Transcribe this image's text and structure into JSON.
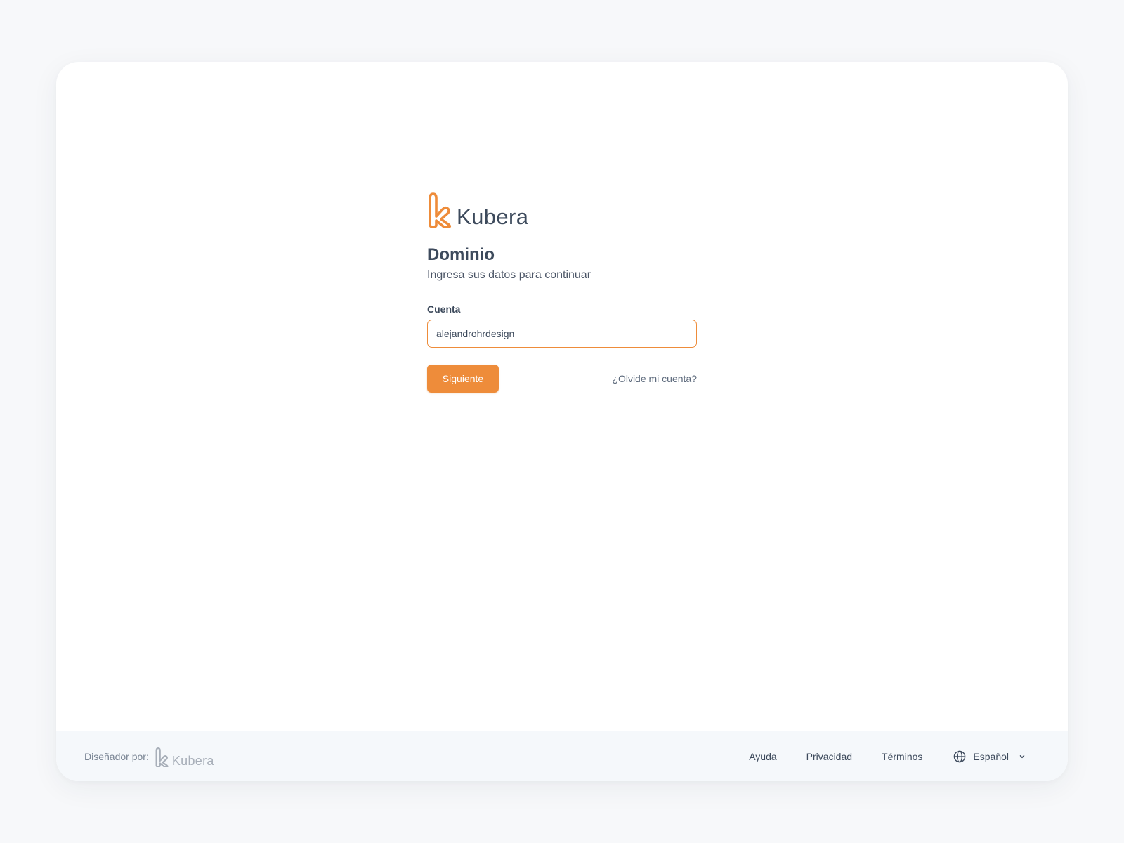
{
  "brand": {
    "name": "Kubera",
    "mark_icon": "kubera-k-logo-icon",
    "accent_color": "#ee8c3a"
  },
  "login": {
    "title": "Dominio",
    "subtitle": "Ingresa sus datos para continuar",
    "account_label": "Cuenta",
    "account_value": "alejandrohrdesign",
    "next_button": "Siguiente",
    "forgot_link": "¿Olvide mi cuenta?"
  },
  "footer": {
    "designed_by": "Diseñador por:",
    "designer_brand": "Kubera",
    "links": [
      "Ayuda",
      "Privacidad",
      "Términos"
    ],
    "language": {
      "icon": "globe-icon",
      "selected": "Español",
      "dropdown_icon": "chevron-down-icon"
    }
  }
}
